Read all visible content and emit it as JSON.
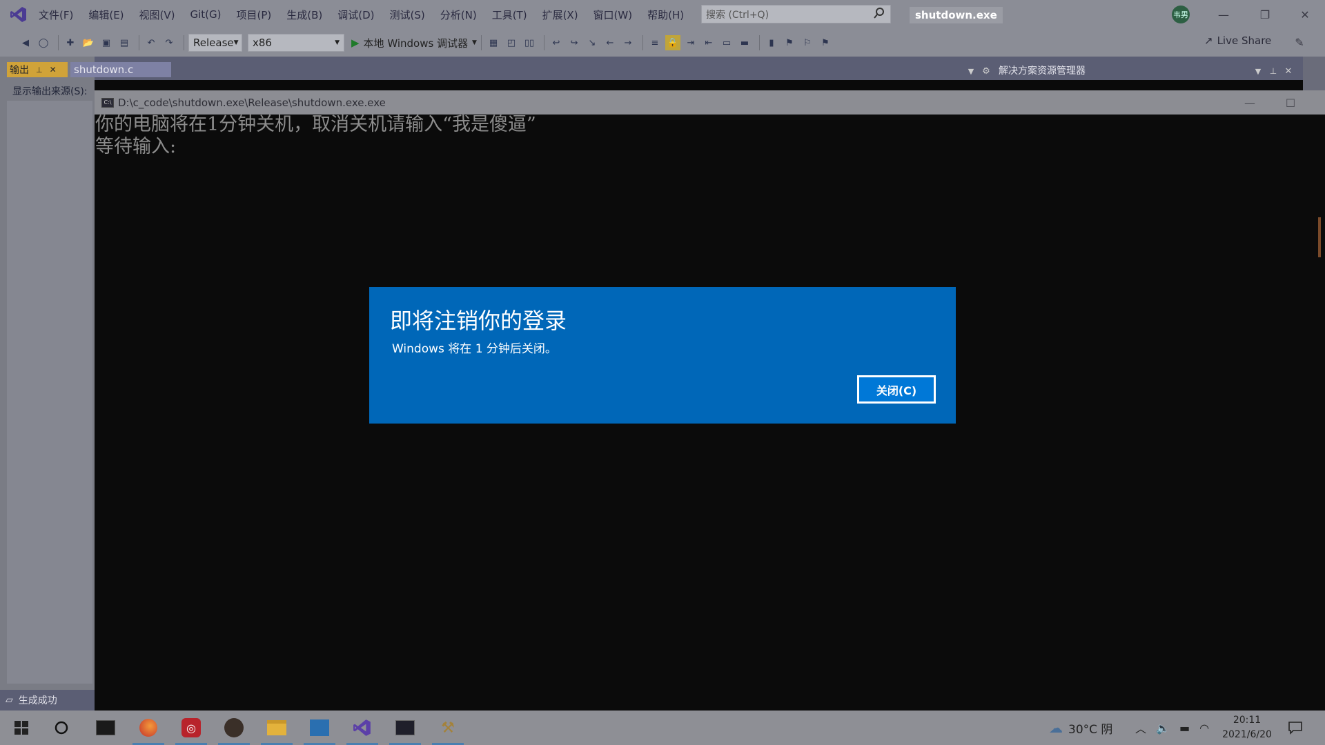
{
  "menubar": {
    "items": [
      "文件(F)",
      "编辑(E)",
      "视图(V)",
      "Git(G)",
      "项目(P)",
      "生成(B)",
      "调试(D)",
      "测试(S)",
      "分析(N)",
      "工具(T)",
      "扩展(X)",
      "窗口(W)",
      "帮助(H)"
    ],
    "search_placeholder": "搜索 (Ctrl+Q)",
    "solution_name": "shutdown.exe",
    "avatar_text": "韦男"
  },
  "toolbar": {
    "configuration": "Release",
    "platform": "x86",
    "run_label": "本地 Windows 调试器",
    "live_share": "Live Share"
  },
  "tabs": {
    "output": "输出",
    "file": "shutdown.c",
    "output_source": "显示输出来源(S):",
    "solution_explorer": "解决方案资源管理器"
  },
  "status": {
    "text": "生成成功"
  },
  "console": {
    "title": "D:\\c_code\\shutdown.exe\\Release\\shutdown.exe.exe",
    "lines": [
      "你的电脑将在1分钟关机，取消关机请输入“我是傻逼”",
      "等待输入:"
    ]
  },
  "dialog": {
    "title": "即将注销你的登录",
    "message": "Windows 将在 1 分钟后关闭。",
    "close_label": "关闭(C)"
  },
  "taskbar": {
    "weather": "30°C 阴",
    "time": "20:11",
    "date": "2021/6/20"
  },
  "colors": {
    "dialog_bg": "#0067b8",
    "vs_purple": "#6f4dbf",
    "output_tab": "#d0a339"
  }
}
